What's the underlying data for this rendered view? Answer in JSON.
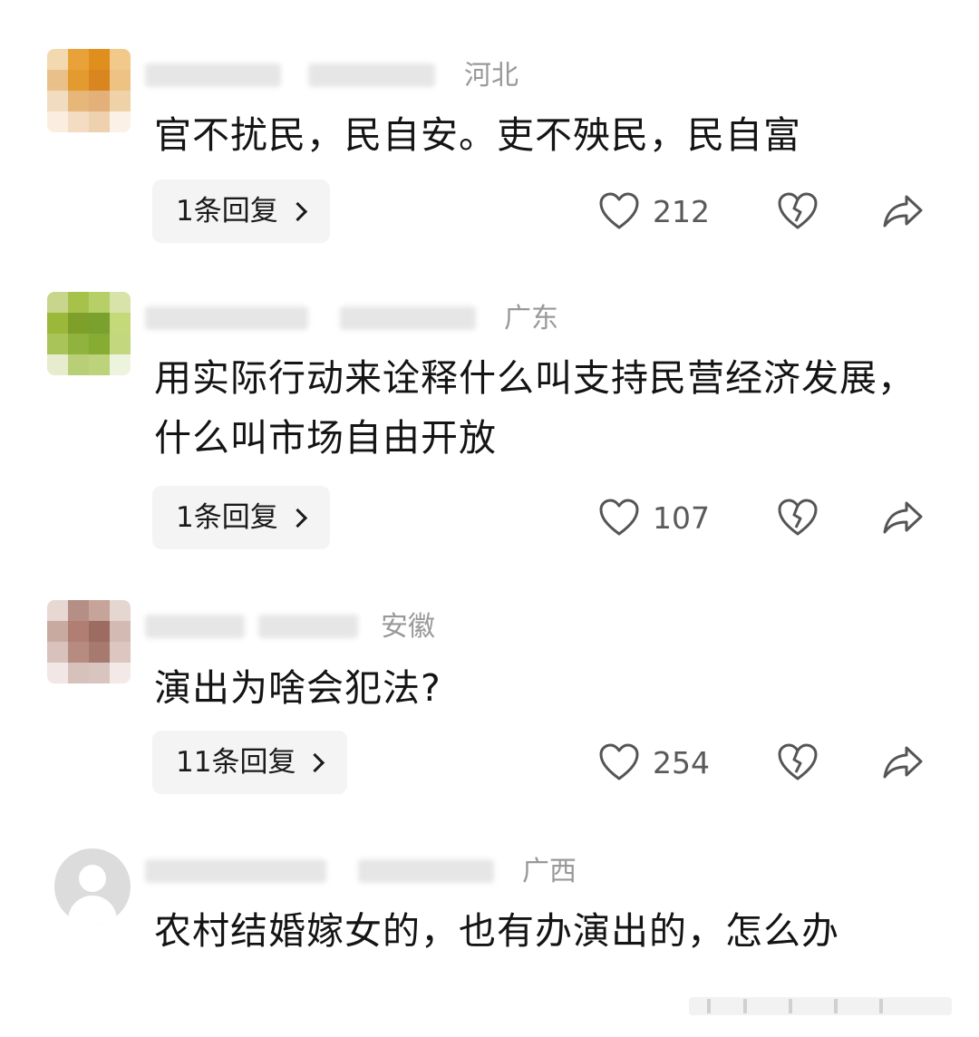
{
  "comments": [
    {
      "region": "河北",
      "text": "官不扰民，民自安。吏不殃民，民自富",
      "reply_label": "1条回复",
      "likes": "212",
      "avatar_colors": [
        "#f3d9b0",
        "#e9a23a",
        "#e08e1c",
        "#f1c98a",
        "#e9c08a",
        "#e39a2e",
        "#d98620",
        "#edc283",
        "#f2dcc0",
        "#e6b779",
        "#e3b07a",
        "#f0d2a8",
        "#fbeee0",
        "#f3dcc2",
        "#eed2b0",
        "#fbf1e6"
      ]
    },
    {
      "region": "广东",
      "text": "用实际行动来诠释什么叫支持民营经济发展，什么叫市场自由开放",
      "reply_label": "1条回复",
      "likes": "107",
      "avatar_colors": [
        "#c7d68a",
        "#a7c24a",
        "#b6cf67",
        "#d7e3a8",
        "#9cb83a",
        "#7e9f2a",
        "#7aa02e",
        "#c5d97a",
        "#a9c55a",
        "#8fb33c",
        "#86ac33",
        "#c2d77e",
        "#e6eccd",
        "#b9cf77",
        "#bcd27b",
        "#eef3dd"
      ]
    },
    {
      "region": "安徽",
      "text": "演出为啥会犯法?",
      "reply_label": "11条回复",
      "likes": "254",
      "avatar_colors": [
        "#e7d8d4",
        "#b58f86",
        "#c7a49a",
        "#e6d6d0",
        "#c9aaa0",
        "#b07e72",
        "#9c6c62",
        "#d3bab2",
        "#d8c2bb",
        "#b68c80",
        "#a77a70",
        "#dcc6bf",
        "#f1e7e4",
        "#d6c1bb",
        "#d9c5c0",
        "#f3eae7"
      ]
    },
    {
      "region": "广西",
      "text": "农村结婚嫁女的，也有办演出的，怎么办"
    }
  ],
  "icons": {
    "like": "heart-icon",
    "dislike": "broken-heart-icon",
    "share": "share-arrow-icon",
    "reply_more": "chevron-right-icon",
    "default_avatar": "default-user-avatar"
  }
}
